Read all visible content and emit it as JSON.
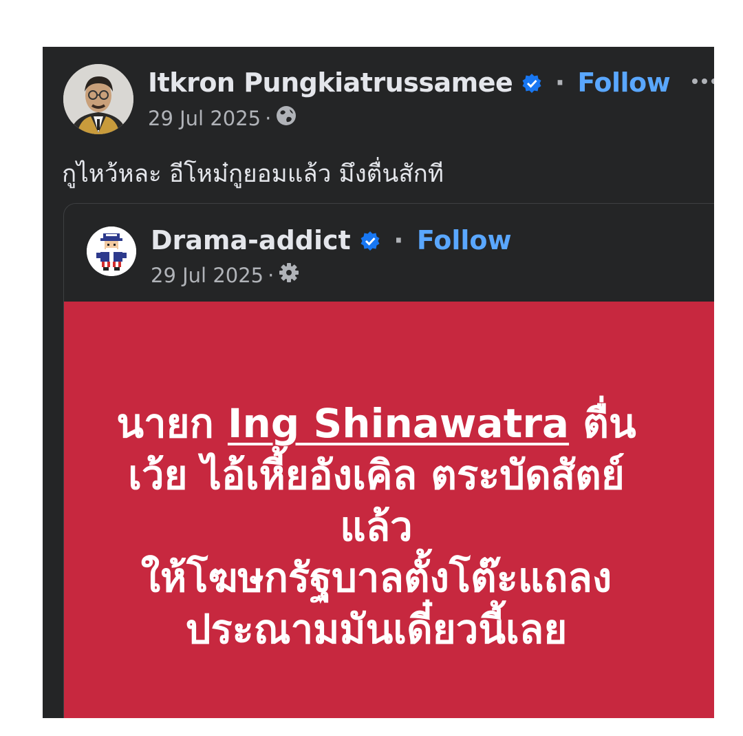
{
  "post": {
    "author": "Itkron Pungkiatrussamee",
    "follow_label": "Follow",
    "date": "29 Jul 2025",
    "separator": "·",
    "audience_icon": "globe-icon",
    "text": "กูไหว้หละ อีโหม๋กูยอมแล้ว มึงตื่นสักที"
  },
  "shared_post": {
    "author": "Drama-addict",
    "follow_label": "Follow",
    "date": "29 Jul 2025",
    "separator": "·",
    "audience_icon": "gear-icon",
    "quote": {
      "line1_prefix": "นายก",
      "mention": "Ing Shinawatra",
      "line1_suffix": "ตื่น",
      "line2": "เว้ย ไอ้เหี้ยอังเคิล ตระบัดสัตย์",
      "line3": "แล้ว",
      "line4": "ให้โฆษกรัฐบาลตั้งโต๊ะแถลง",
      "line5": "ประณามมันเดี๋ยวนี้เลย"
    }
  },
  "colors": {
    "card_background": "#242526",
    "text_primary": "#e4e6eb",
    "text_secondary": "#b0b3b8",
    "link_blue": "#5aa7ff",
    "verified_blue": "#1877f2",
    "red_panel": "#c7283f"
  }
}
